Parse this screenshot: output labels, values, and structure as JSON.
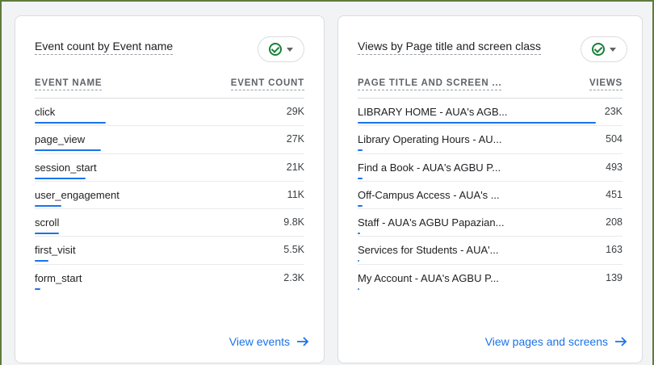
{
  "cards": [
    {
      "title": "Event count by Event name",
      "col_label": "EVENT NAME",
      "col_value": "EVENT COUNT",
      "rows": [
        {
          "label": "click",
          "value": "29K",
          "fraction": 1.0
        },
        {
          "label": "page_view",
          "value": "27K",
          "fraction": 0.93
        },
        {
          "label": "session_start",
          "value": "21K",
          "fraction": 0.72
        },
        {
          "label": "user_engagement",
          "value": "11K",
          "fraction": 0.38
        },
        {
          "label": "scroll",
          "value": "9.8K",
          "fraction": 0.34
        },
        {
          "label": "first_visit",
          "value": "5.5K",
          "fraction": 0.19
        },
        {
          "label": "form_start",
          "value": "2.3K",
          "fraction": 0.08
        }
      ],
      "link": "View events"
    },
    {
      "title": "Views by Page title and screen class",
      "col_label": "PAGE TITLE AND SCREEN ...",
      "col_value": "VIEWS",
      "rows": [
        {
          "label": "LIBRARY HOME - AUA's AGB...",
          "value": "23K",
          "fraction": 1.0
        },
        {
          "label": "Library Operating Hours - AU...",
          "value": "504",
          "fraction": 0.022
        },
        {
          "label": "Find a Book - AUA's AGBU P...",
          "value": "493",
          "fraction": 0.021
        },
        {
          "label": "Off-Campus Access - AUA's ...",
          "value": "451",
          "fraction": 0.02
        },
        {
          "label": "Staff - AUA's AGBU Papazian...",
          "value": "208",
          "fraction": 0.009
        },
        {
          "label": "Services for Students - AUA'...",
          "value": "163",
          "fraction": 0.007
        },
        {
          "label": "My Account - AUA's AGBU P...",
          "value": "139",
          "fraction": 0.006
        }
      ],
      "link": "View pages and screens"
    }
  ],
  "colors": {
    "accent": "#1a73e8",
    "check": "#188038"
  },
  "icons": {
    "chip": "check-circle-icon",
    "caret": "caret-down-icon",
    "link": "arrow-right-icon"
  }
}
